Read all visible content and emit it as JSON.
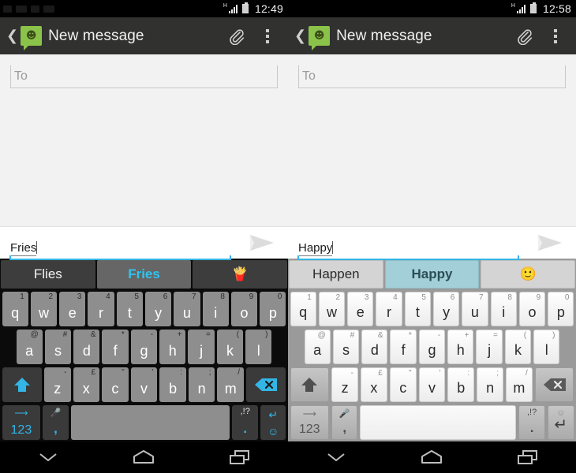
{
  "panels": [
    {
      "theme": "dark",
      "status": {
        "time": "12:49",
        "network": "H",
        "signal_icon": "signal-icon",
        "battery_icon": "battery-icon"
      },
      "actionbar": {
        "back_icon": "back-chevron-icon",
        "app_icon": "messaging-app-icon",
        "title": "New message",
        "attach_icon": "paperclip-icon",
        "overflow_icon": "overflow-menu-icon"
      },
      "to_field": {
        "placeholder": "To",
        "value": ""
      },
      "composer": {
        "text": "Fries",
        "send_icon": "send-icon"
      },
      "suggestions": [
        {
          "label": "Flies",
          "selected": false,
          "type": "word"
        },
        {
          "label": "Fries",
          "selected": true,
          "type": "word"
        },
        {
          "label": "🍟",
          "selected": false,
          "type": "emoji"
        }
      ]
    },
    {
      "theme": "light",
      "status": {
        "time": "12:58",
        "network": "H",
        "signal_icon": "signal-icon",
        "battery_icon": "battery-icon"
      },
      "actionbar": {
        "back_icon": "back-chevron-icon",
        "app_icon": "messaging-app-icon",
        "title": "New message",
        "attach_icon": "paperclip-icon",
        "overflow_icon": "overflow-menu-icon"
      },
      "to_field": {
        "placeholder": "To",
        "value": ""
      },
      "composer": {
        "text": "Happy",
        "send_icon": "send-icon"
      },
      "suggestions": [
        {
          "label": "Happen",
          "selected": false,
          "type": "word"
        },
        {
          "label": "Happy",
          "selected": true,
          "type": "word"
        },
        {
          "label": "🙂",
          "selected": false,
          "type": "emoji"
        }
      ]
    }
  ],
  "keyboard": {
    "row1": [
      {
        "key": "q",
        "alt": "1"
      },
      {
        "key": "w",
        "alt": "2"
      },
      {
        "key": "e",
        "alt": "3"
      },
      {
        "key": "r",
        "alt": "4"
      },
      {
        "key": "t",
        "alt": "5"
      },
      {
        "key": "y",
        "alt": "6"
      },
      {
        "key": "u",
        "alt": "7"
      },
      {
        "key": "i",
        "alt": "8"
      },
      {
        "key": "o",
        "alt": "9"
      },
      {
        "key": "p",
        "alt": "0"
      }
    ],
    "row2": [
      {
        "key": "a",
        "alt": "@"
      },
      {
        "key": "s",
        "alt": "#"
      },
      {
        "key": "d",
        "alt": "&"
      },
      {
        "key": "f",
        "alt": "*"
      },
      {
        "key": "g",
        "alt": "-"
      },
      {
        "key": "h",
        "alt": "+"
      },
      {
        "key": "j",
        "alt": "="
      },
      {
        "key": "k",
        "alt": "("
      },
      {
        "key": "l",
        "alt": ")"
      }
    ],
    "row3": [
      {
        "key": "z",
        "alt": "-"
      },
      {
        "key": "x",
        "alt": "£"
      },
      {
        "key": "c",
        "alt": "\""
      },
      {
        "key": "v",
        "alt": "'"
      },
      {
        "key": "b",
        "alt": ":"
      },
      {
        "key": "n",
        "alt": ";"
      },
      {
        "key": "m",
        "alt": "/"
      }
    ],
    "shift_icon": "shift-arrow-icon",
    "backspace_icon": "backspace-icon",
    "symbols_label": "123",
    "swipe_icon": "swipe-flow-icon",
    "mic_icon": "microphone-icon",
    "comma_label": ",",
    "space_label": "",
    "punct_top": ",!?",
    "punct_bottom": ".",
    "enter_icon": "enter-return-icon",
    "emoji_icon": "smiley-icon"
  },
  "navbar": {
    "back_icon": "keyboard-dismiss-chevron-icon",
    "home_icon": "home-icon",
    "recents_icon": "recent-apps-icon"
  },
  "colors": {
    "accent_cyan": "#33b5e5",
    "app_green": "#8bc34a",
    "actionbar_bg": "#31312f",
    "dark_key": "#8e8e8e",
    "light_selected_suggestion": "#a3cfd8"
  }
}
